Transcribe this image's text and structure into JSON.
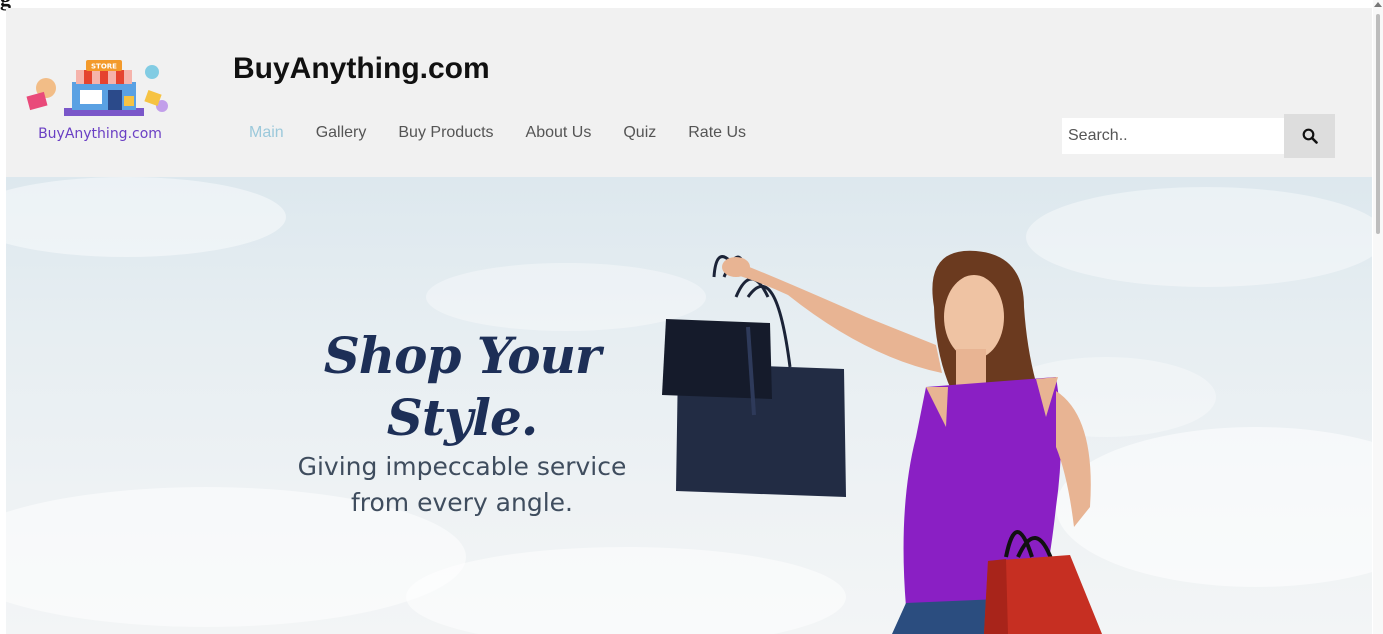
{
  "header": {
    "site_title": "BuyAnything.com",
    "logo_text": "BuyAnything.com",
    "logo_store_sign": "STORE",
    "search": {
      "placeholder": "Search..",
      "button_icon": "search-icon"
    }
  },
  "nav": {
    "items": [
      {
        "label": "Main",
        "active": true
      },
      {
        "label": "Gallery",
        "active": false
      },
      {
        "label": "Buy Products",
        "active": false
      },
      {
        "label": "About Us",
        "active": false
      },
      {
        "label": "Quiz",
        "active": false
      },
      {
        "label": "Rate Us",
        "active": false
      }
    ]
  },
  "hero": {
    "headline": "Shop Your Style.",
    "subline_1": "Giving impeccable service",
    "subline_2": "from every angle."
  },
  "colors": {
    "header_bg": "#f1f1f1",
    "nav_active": "#9cc9db",
    "nav_text": "#555555",
    "headline": "#1d2f57",
    "top_purple": "#8a1fc4",
    "bag_navy": "#1f2a44",
    "bag_red": "#c62f22"
  }
}
